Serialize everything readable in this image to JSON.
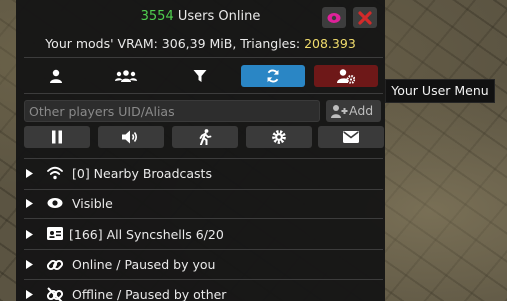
{
  "header": {
    "users_online_count": "3554",
    "users_online_label": "Users Online",
    "toggle_visibility_icon": "eye-icon",
    "disconnect_icon": "x-icon"
  },
  "stats": {
    "vram_prefix": "Your mods' VRAM: 306,39 MiB, Triangles: ",
    "triangles_value": "208.393"
  },
  "tabs": [
    {
      "icon": "user-icon",
      "name": "individual-pairs"
    },
    {
      "icon": "users-icon",
      "name": "syncshells"
    },
    {
      "icon": "filter-icon",
      "name": "filter"
    },
    {
      "icon": "refresh-icon",
      "name": "refresh"
    },
    {
      "icon": "user-gear-icon",
      "name": "user-menu"
    }
  ],
  "add_pair": {
    "placeholder": "Other players UID/Alias",
    "value": "",
    "add_label": "Add"
  },
  "controls": [
    {
      "icon": "pause-icon"
    },
    {
      "icon": "volume-icon"
    },
    {
      "icon": "running-icon"
    },
    {
      "icon": "gear-icon"
    },
    {
      "icon": "envelope-icon"
    }
  ],
  "groups": [
    {
      "icon": "wifi-icon",
      "label": "[0] Nearby Broadcasts"
    },
    {
      "icon": "eye-icon",
      "label": "Visible"
    },
    {
      "icon": "id-card-icon",
      "label": "[166]  All Syncshells 6/20"
    },
    {
      "icon": "link-icon",
      "label": "Online / Paused by you"
    },
    {
      "icon": "unlink-icon",
      "label": "Offline / Paused by other"
    }
  ],
  "tooltip": {
    "text": "Your User Menu"
  },
  "colors": {
    "online_count": "#4fcf4f",
    "triangles": "#f0dc6c",
    "refresh_active": "#2a86c5",
    "user_menu_active": "#6e1818",
    "eye_icon": "#e0219a",
    "x_icon": "#d42a2a"
  }
}
